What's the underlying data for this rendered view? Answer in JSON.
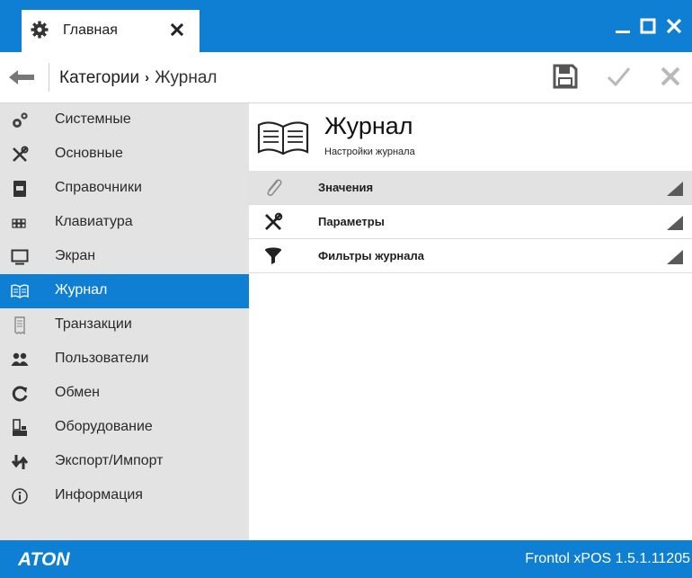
{
  "window": {
    "tab_title": "Главная",
    "brand_color": "#0f7fd3"
  },
  "navbar": {
    "breadcrumb_root": "Категории",
    "breadcrumb_separator": "›",
    "breadcrumb_current": "Журнал"
  },
  "sidebar": {
    "items": [
      {
        "label": "Системные",
        "icon": "gears-icon"
      },
      {
        "label": "Основные",
        "icon": "tools-icon"
      },
      {
        "label": "Справочники",
        "icon": "book-icon"
      },
      {
        "label": "Клавиатура",
        "icon": "keyboard-icon"
      },
      {
        "label": "Экран",
        "icon": "monitor-icon"
      },
      {
        "label": "Журнал",
        "icon": "journal-icon",
        "active": true
      },
      {
        "label": "Транзакции",
        "icon": "receipt-icon"
      },
      {
        "label": "Пользователи",
        "icon": "users-icon"
      },
      {
        "label": "Обмен",
        "icon": "sync-icon"
      },
      {
        "label": "Оборудование",
        "icon": "hardware-icon"
      },
      {
        "label": "Экспорт/Импорт",
        "icon": "export-import-icon"
      },
      {
        "label": "Информация",
        "icon": "info-icon"
      }
    ]
  },
  "main": {
    "title": "Журнал",
    "subtitle": "Настройки журнала",
    "sections": [
      {
        "label": "Значения",
        "icon": "paperclip-icon",
        "selected": true
      },
      {
        "label": "Параметры",
        "icon": "tools-icon"
      },
      {
        "label": "Фильтры журнала",
        "icon": "filter-icon"
      }
    ]
  },
  "footer": {
    "logo_text": "ATON",
    "version": "Frontol xPOS 1.5.1.11205"
  }
}
